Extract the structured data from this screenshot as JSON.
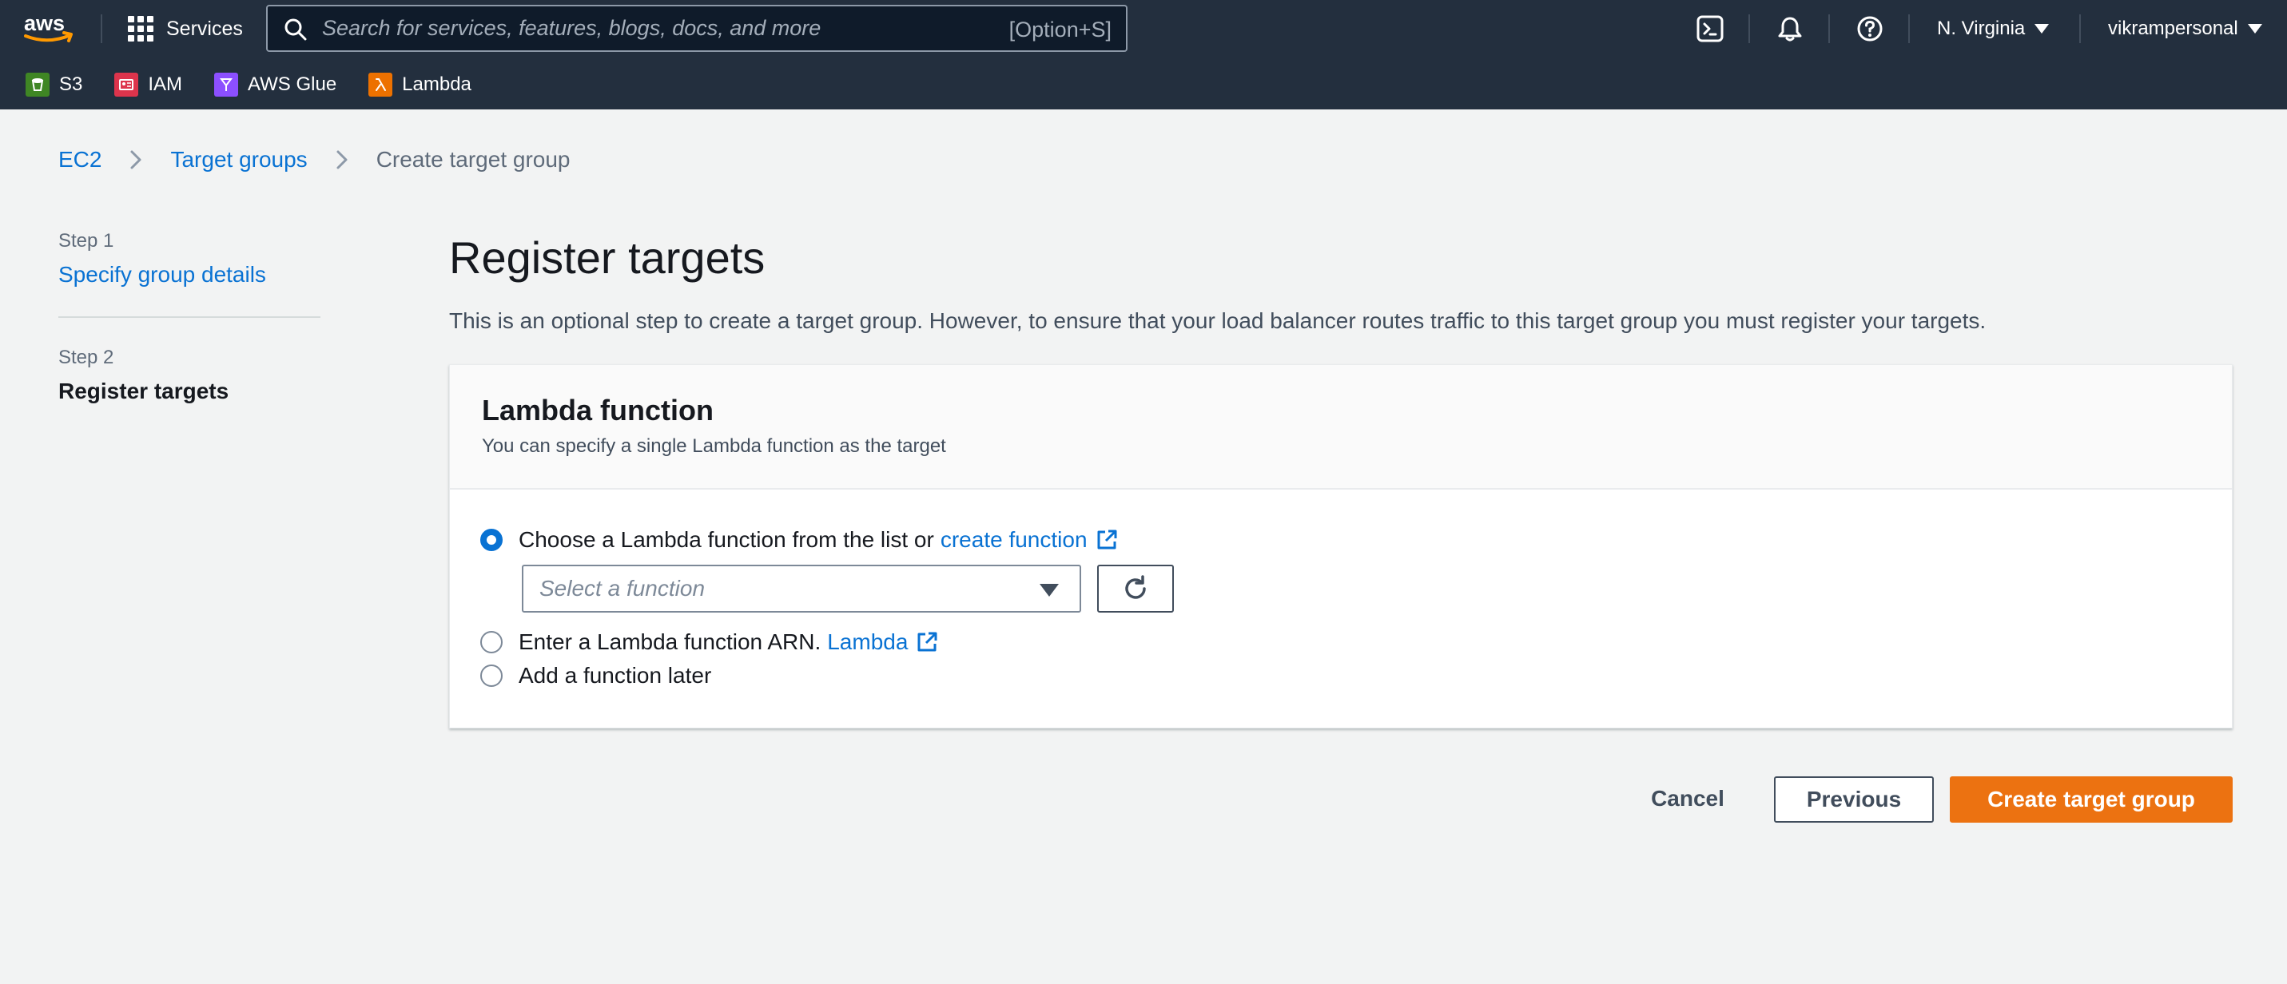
{
  "topnav": {
    "logo_text": "aws",
    "services_label": "Services",
    "search_placeholder": "Search for services, features, blogs, docs, and more",
    "search_shortcut": "[Option+S]",
    "region": "N. Virginia",
    "account": "vikrampersonal",
    "favorites": [
      {
        "label": "S3",
        "icon": "s3-icon",
        "color": "#3f8624"
      },
      {
        "label": "IAM",
        "icon": "iam-icon",
        "color": "#dd344c"
      },
      {
        "label": "AWS Glue",
        "icon": "glue-icon",
        "color": "#8c4fff"
      },
      {
        "label": "Lambda",
        "icon": "lambda-icon",
        "color": "#ed7100"
      }
    ]
  },
  "breadcrumb": {
    "items": [
      "EC2",
      "Target groups"
    ],
    "current": "Create target group"
  },
  "steps": {
    "step1_num": "Step 1",
    "step1_label": "Specify group details",
    "step2_num": "Step 2",
    "step2_label": "Register targets"
  },
  "main": {
    "title": "Register targets",
    "description": "This is an optional step to create a target group. However, to ensure that your load balancer routes traffic to this target group you must register your targets."
  },
  "panel": {
    "title": "Lambda function",
    "subtitle": "You can specify a single Lambda function as the target",
    "option1_text": "Choose a Lambda function from the list or",
    "option1_link": "create function",
    "select_placeholder": "Select a function",
    "option2_text": "Enter a Lambda function ARN.",
    "option2_link": "Lambda",
    "option3_text": "Add a function later",
    "selected_option": "option1"
  },
  "actions": {
    "cancel": "Cancel",
    "previous": "Previous",
    "create": "Create target group"
  },
  "colors": {
    "nav_bg": "#232f3e",
    "link": "#0972d3",
    "primary_button": "#ec7211",
    "page_bg": "#f2f3f3"
  }
}
